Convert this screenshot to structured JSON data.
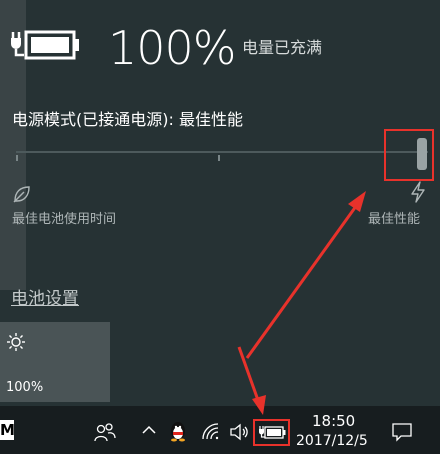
{
  "battery": {
    "percent": "100%",
    "status": "电量已充满",
    "level": 1.0
  },
  "power_mode": {
    "label": "电源模式(已接通电源): 最佳性能",
    "slider_level": 1.0,
    "left_label": "最佳电池使用时间",
    "right_label": "最佳性能",
    "left_icon": "leaf-icon",
    "right_icon": "bolt-icon"
  },
  "settings_link": "电池设置",
  "brightness_tile": {
    "icon": "sun-icon",
    "value": "100%"
  },
  "taskbar": {
    "app_letter": "M",
    "time": "18:50",
    "date": "2017/12/5",
    "icons": [
      "people-icon",
      "chevron-up-icon",
      "qq-penguin-icon",
      "wifi-icon",
      "volume-icon",
      "battery-plug-icon",
      "notification-icon"
    ]
  },
  "colors": {
    "background": "#263234",
    "taskbar": "#171d1f",
    "tile": "#4a5456",
    "annotation": "#e8322b"
  }
}
